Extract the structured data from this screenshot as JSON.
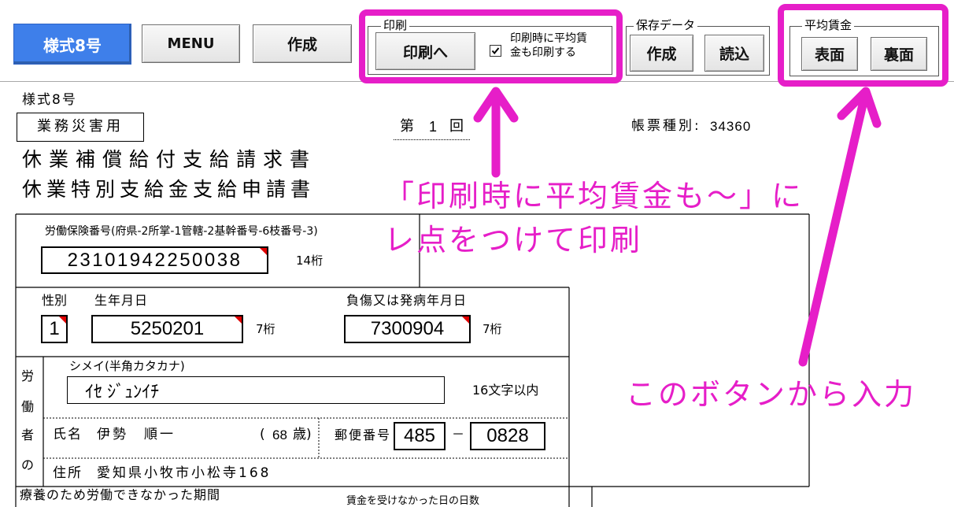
{
  "toolbar": {
    "form_button_label": "様式8号",
    "menu_button_label": "MENU",
    "create_button_label": "作成",
    "print_group": {
      "title": "印刷",
      "print_button_label": "印刷へ",
      "checkbox_label": [
        "印刷時に平均賃",
        "金も印刷する"
      ],
      "checkbox_checked": true
    },
    "save_group": {
      "title": "保存データ",
      "create_button_label": "作成",
      "load_button_label": "読込"
    },
    "wage_group": {
      "title": "平均賃金",
      "front_button_label": "表面",
      "back_button_label": "裏面"
    }
  },
  "sheet": {
    "form_number": "様式8号",
    "category": "業務災害用",
    "round": {
      "prefix": "第",
      "value": "1",
      "suffix": "回"
    },
    "form_type": {
      "label": "帳票種別:",
      "value": "34360"
    },
    "title_lines": [
      "休業補償給付支給請求書",
      "休業特別支給金支給申請書"
    ],
    "insurance_number": {
      "label": "労働保険番号(府県-2所掌-1管轄-2基幹番号-6枝番号-3)",
      "value": "23101942250038",
      "hint": "14桁"
    },
    "gender": {
      "label": "性別",
      "value": "1"
    },
    "birth_date": {
      "label": "生年月日",
      "value": "5250201",
      "hint": "7桁"
    },
    "injury_date": {
      "label": "負傷又は発病年月日",
      "value": "7300904",
      "hint": "7桁"
    },
    "worker": {
      "section_label": [
        "労",
        "働",
        "者",
        "の"
      ],
      "kana_label": "シメイ(半角カタカナ)",
      "kana_value": "ｲｾ ｼﾞｭﾝｲﾁ",
      "kana_hint": "16文字以内",
      "name_label": "氏名",
      "name_value": "伊勢　順一",
      "age": {
        "prefix": "(",
        "value": "68",
        "suffix": "歳)"
      },
      "postal_label": "郵便番号",
      "postal_code": [
        "485",
        "0828"
      ],
      "postal_separator": "－",
      "address_label": "住所",
      "address_value": "愛知県小牧市小松寺168"
    },
    "leave_period_label": "療養のため労働できなかった期間",
    "unpaid_days_label": "賃金を受けなかった日の日数"
  },
  "annotations": {
    "print_note": [
      "「印刷時に平均賃金も～」に",
      "レ点をつけて印刷"
    ],
    "wage_note": "このボタンから入力"
  },
  "colors": {
    "primary_button": "#3e7fea",
    "annotation": "#e61ec8",
    "comment_indicator": "#e00000"
  }
}
